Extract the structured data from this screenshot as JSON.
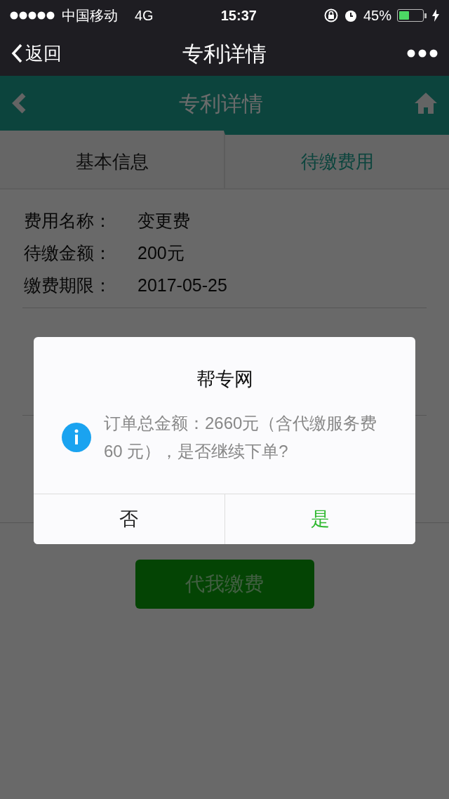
{
  "status_bar": {
    "carrier": "中国移动",
    "network": "4G",
    "time": "15:37",
    "battery_text": "45%",
    "battery": {
      "level": 0.45
    }
  },
  "nav": {
    "back": "返回",
    "title": "专利详情"
  },
  "header": {
    "title": "专利详情"
  },
  "tabs": [
    {
      "label": "基本信息",
      "selected": false
    },
    {
      "label": "待缴费用",
      "selected": true
    }
  ],
  "fees": [
    {
      "rows": [
        {
          "label": "费用名称：",
          "value": "变更费"
        },
        {
          "label": "待缴金额：",
          "value": "200元"
        },
        {
          "label": "缴费期限：",
          "value": "2017-05-25"
        }
      ]
    }
  ],
  "pay_button": "代我缴费",
  "dialog": {
    "title": "帮专网",
    "message": "订单总金额：2660元（含代缴服务费 60 元），是否继续下单?",
    "buttons": [
      {
        "label": "否",
        "kind": "cancel"
      },
      {
        "label": "是",
        "kind": "confirm"
      }
    ]
  }
}
